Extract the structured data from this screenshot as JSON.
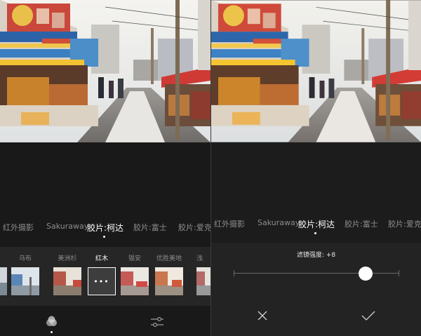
{
  "left": {
    "categories": [
      {
        "label": "红外摄影",
        "active": false
      },
      {
        "label": "Sakuraway",
        "active": false
      },
      {
        "label": "胶片:柯达",
        "active": true
      },
      {
        "label": "胶片:富士",
        "active": false
      },
      {
        "label": "胶片:爱克",
        "active": false
      }
    ],
    "filters": [
      {
        "label": "乌布",
        "active": false
      },
      {
        "label": "美洲杉",
        "active": false
      },
      {
        "label": "红木",
        "active": true
      },
      {
        "label": "锡安",
        "active": false
      },
      {
        "label": "优胜美地",
        "active": false
      },
      {
        "label": "浅",
        "active": false
      }
    ],
    "selected_more": "•••",
    "icons": {
      "filters_tab": "filters-tab-icon",
      "adjust_tab": "adjust-sliders-icon"
    }
  },
  "right": {
    "categories": [
      {
        "label": "红外摄影",
        "active": false
      },
      {
        "label": "Sakuraway",
        "active": false
      },
      {
        "label": "胶片:柯达",
        "active": true
      },
      {
        "label": "胶片:富士",
        "active": false
      },
      {
        "label": "胶片:爱克",
        "active": false
      }
    ],
    "strength_label": "滤镜强度: +8",
    "strength_value": 8,
    "icons": {
      "cancel": "close-icon",
      "confirm": "check-icon"
    }
  },
  "colors": {
    "accent": "#ffffff",
    "panel_bg": "#1b1b1b",
    "strip_bg": "#262626"
  }
}
